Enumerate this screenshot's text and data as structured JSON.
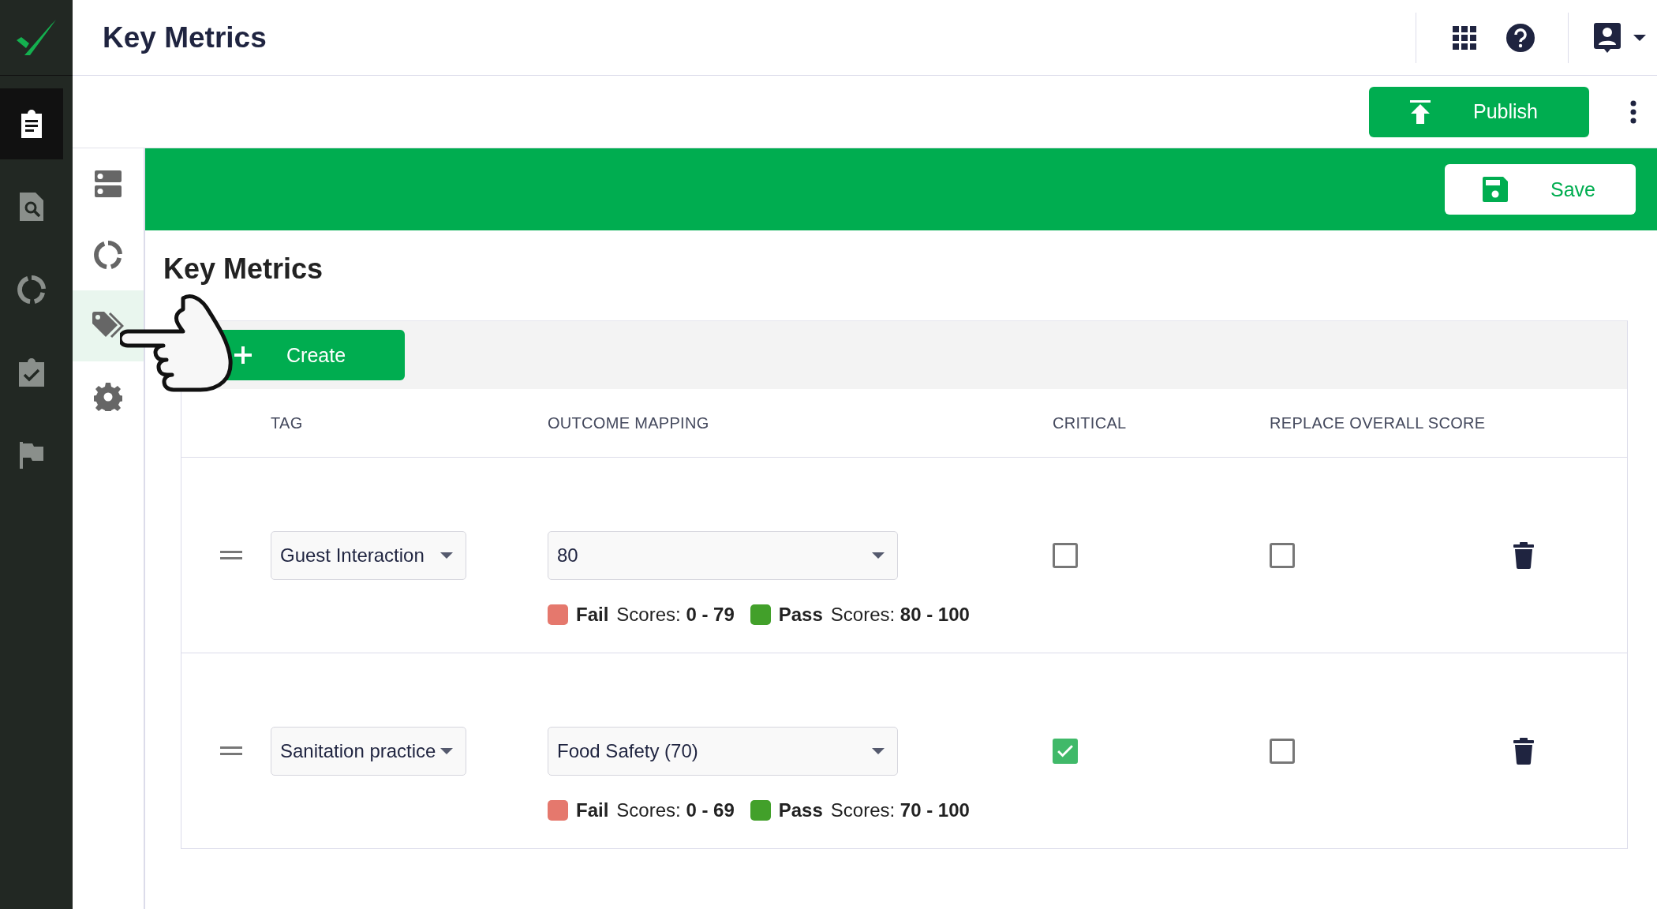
{
  "app_bar": {
    "title": "Key Metrics"
  },
  "rail": {
    "items": [
      {
        "kind": "clipboard",
        "selected": true
      },
      {
        "kind": "search-doc",
        "selected": false
      },
      {
        "kind": "ring",
        "selected": false
      },
      {
        "kind": "check-clipboard",
        "selected": false
      },
      {
        "kind": "flag",
        "selected": false
      }
    ]
  },
  "toolbar": {
    "publish": "Publish"
  },
  "subnav": {
    "items": [
      {
        "kind": "sections",
        "selected": false
      },
      {
        "kind": "ring",
        "selected": false
      },
      {
        "kind": "tags",
        "selected": true
      },
      {
        "kind": "gear",
        "selected": false
      }
    ]
  },
  "banner": {
    "save": "Save"
  },
  "section": {
    "title": "Key Metrics",
    "create": "Create"
  },
  "table": {
    "columns": [
      "TAG",
      "OUTCOME MAPPING",
      "CRITICAL",
      "REPLACE OVERALL SCORE"
    ],
    "rows": [
      {
        "tag": "Guest Interaction",
        "outcome": "80",
        "critical": false,
        "replace_overall_score": false,
        "ranges": [
          {
            "label": "Fail",
            "prefix": "Scores:",
            "range": "0 - 79",
            "color": "#e5786d"
          },
          {
            "label": "Pass",
            "prefix": "Scores:",
            "range": "80 - 100",
            "color": "#42a02a"
          }
        ]
      },
      {
        "tag": "Sanitation practice",
        "outcome": "Food Safety (70)",
        "critical": true,
        "replace_overall_score": false,
        "ranges": [
          {
            "label": "Fail",
            "prefix": "Scores:",
            "range": "0 - 69",
            "color": "#e5786d"
          },
          {
            "label": "Pass",
            "prefix": "Scores:",
            "range": "70 - 100",
            "color": "#42a02a"
          }
        ]
      }
    ]
  }
}
